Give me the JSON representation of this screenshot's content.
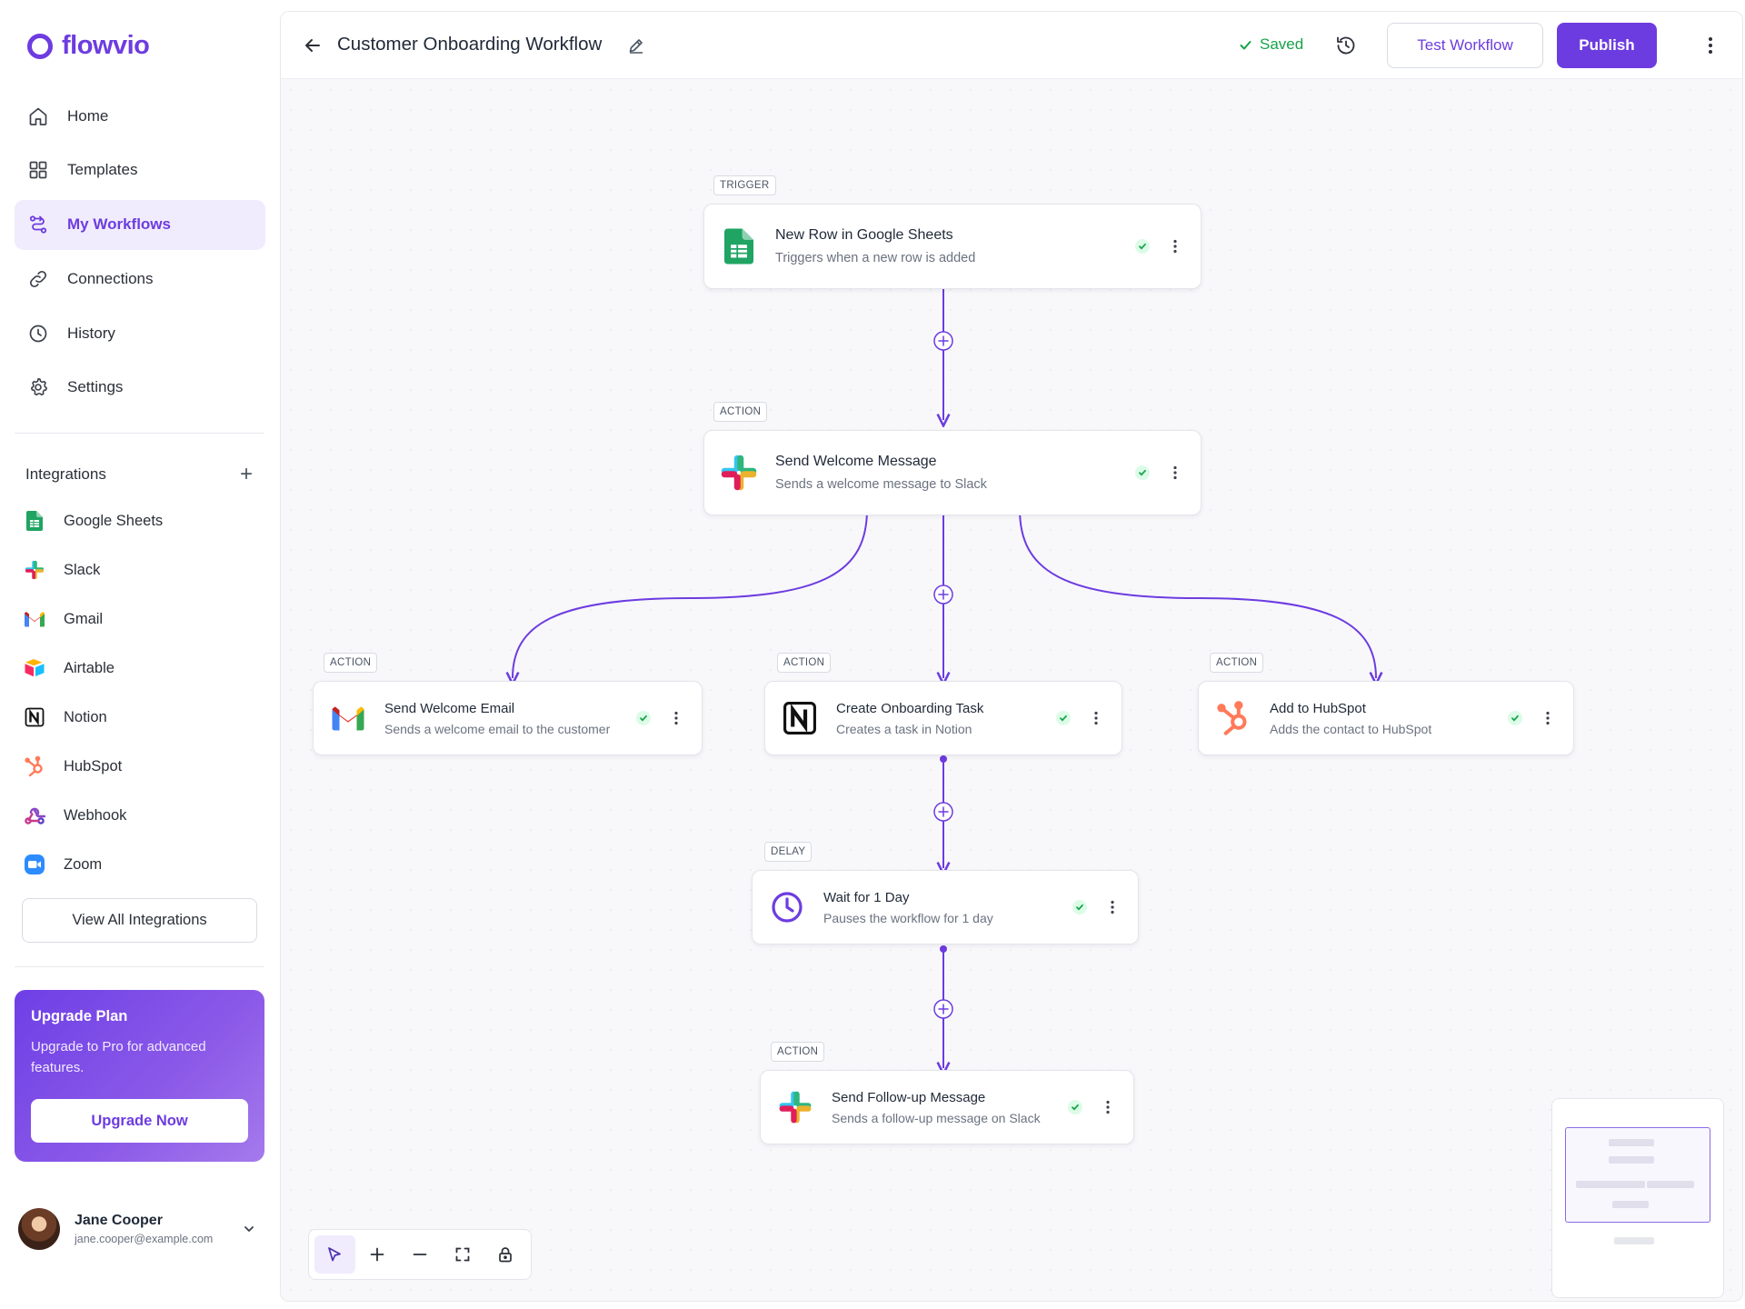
{
  "app": {
    "name": "flowvio"
  },
  "nav": [
    {
      "label": "Home",
      "icon": "home-icon"
    },
    {
      "label": "Templates",
      "icon": "grid-icon"
    },
    {
      "label": "My Workflows",
      "icon": "workflow-icon",
      "active": true
    },
    {
      "label": "Connections",
      "icon": "link-icon"
    },
    {
      "label": "History",
      "icon": "clock-icon"
    },
    {
      "label": "Settings",
      "icon": "gear-icon"
    }
  ],
  "integrations": {
    "title": "Integrations",
    "items": [
      {
        "label": "Google Sheets",
        "icon": "google-sheets-icon"
      },
      {
        "label": "Slack",
        "icon": "slack-icon"
      },
      {
        "label": "Gmail",
        "icon": "gmail-icon"
      },
      {
        "label": "Airtable",
        "icon": "airtable-icon"
      },
      {
        "label": "Notion",
        "icon": "notion-icon"
      },
      {
        "label": "HubSpot",
        "icon": "hubspot-icon"
      },
      {
        "label": "Webhook",
        "icon": "webhook-icon"
      },
      {
        "label": "Zoom",
        "icon": "zoom-icon"
      }
    ],
    "view_all": "View All Integrations"
  },
  "upgrade": {
    "title": "Upgrade Plan",
    "description": "Upgrade to Pro for advanced features.",
    "button": "Upgrade Now"
  },
  "user": {
    "name": "Jane Cooper",
    "email": "jane.cooper@example.com"
  },
  "header": {
    "title": "Customer Onboarding Workflow",
    "status": "Saved",
    "test_button": "Test Workflow",
    "publish_button": "Publish"
  },
  "workflow": {
    "nodes": {
      "trigger": {
        "tag": "TRIGGER",
        "name": "New Row in Google Sheets",
        "desc": "Triggers when a new row is added",
        "icon": "google-sheets-icon",
        "status": "ok"
      },
      "welcome_message": {
        "tag": "ACTION",
        "name": "Send Welcome Message",
        "desc": "Sends a welcome message to Slack",
        "icon": "slack-icon",
        "status": "ok"
      },
      "welcome_email": {
        "tag": "ACTION",
        "name": "Send Welcome Email",
        "desc": "Sends a welcome email to the customer",
        "icon": "gmail-icon",
        "status": "ok"
      },
      "onboarding_task": {
        "tag": "ACTION",
        "name": "Create Onboarding Task",
        "desc": "Creates a task in Notion",
        "icon": "notion-icon",
        "status": "ok"
      },
      "hubspot": {
        "tag": "ACTION",
        "name": "Add to HubSpot",
        "desc": "Adds the contact to HubSpot",
        "icon": "hubspot-icon",
        "status": "ok"
      },
      "delay": {
        "tag": "DELAY",
        "name": "Wait for 1 Day",
        "desc": "Pauses the workflow for 1 day",
        "icon": "clock-icon",
        "status": "ok"
      },
      "followup": {
        "tag": "ACTION",
        "name": "Send Follow-up Message",
        "desc": "Sends a follow-up message on Slack",
        "icon": "slack-icon",
        "status": "ok"
      }
    }
  },
  "colors": {
    "accent": "#6d3ce0",
    "success": "#16a34a",
    "edge": "#6d3ce0"
  }
}
